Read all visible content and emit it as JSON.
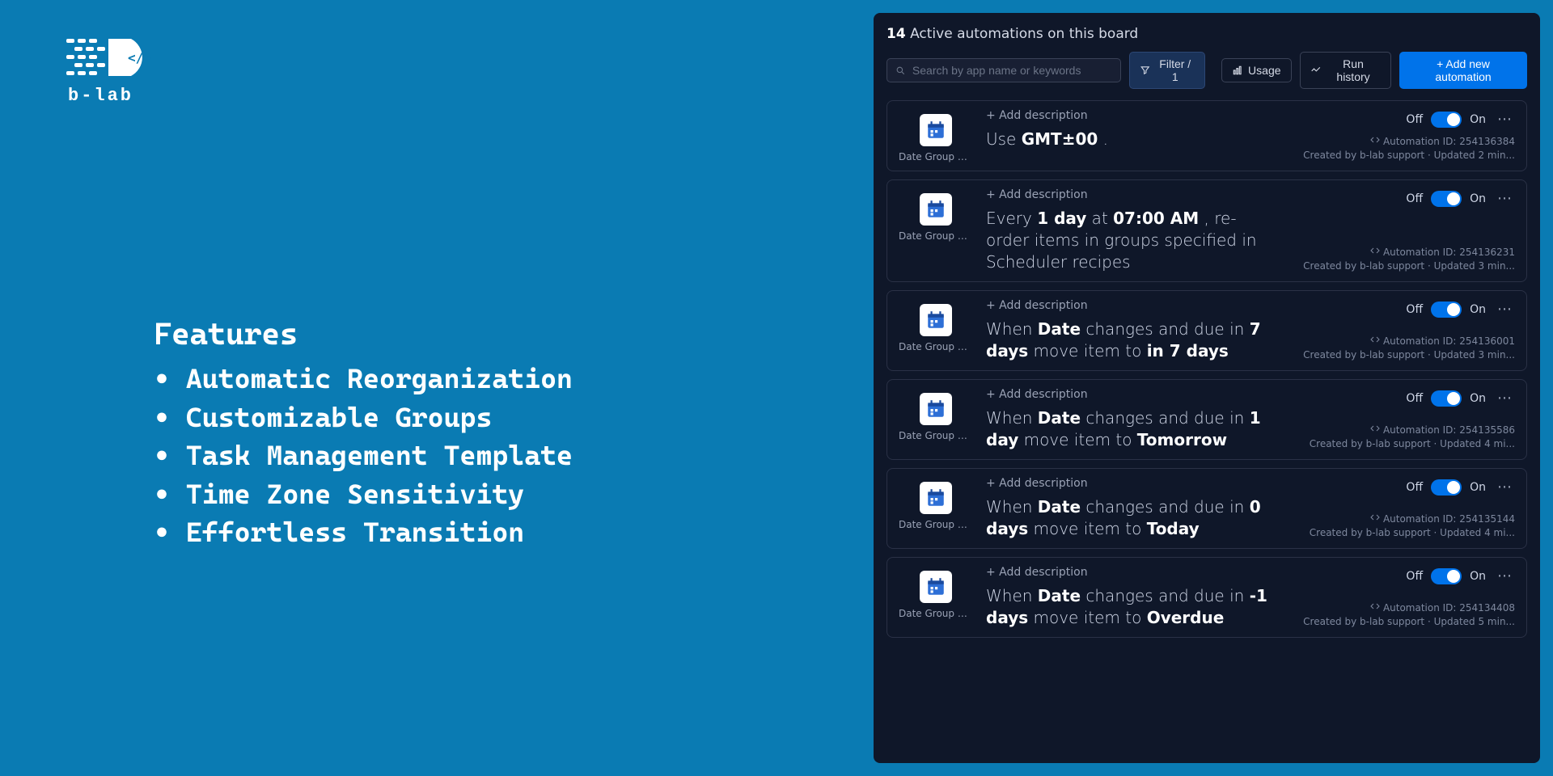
{
  "brand": "b-lab",
  "features": {
    "title": "Features",
    "items": [
      "Automatic Reorganization",
      "Customizable Groups",
      "Task Management Template",
      "Time Zone Sensitivity",
      "Effortless Transition"
    ]
  },
  "header": {
    "count": "14",
    "label": "Active automations on this board"
  },
  "toolbar": {
    "search_placeholder": "Search by app name or keywords",
    "filter_label": "Filter / 1",
    "usage_label": "Usage",
    "history_label": "Run history",
    "add_label": "+ Add new automation"
  },
  "common": {
    "add_description": "+ Add description",
    "off": "Off",
    "on": "On",
    "app_name": "Date Group Ma...",
    "automation_id_prefix": "Automation ID:",
    "created_by": "Created by b-lab support"
  },
  "automations": [
    {
      "sentence_html": "Use <b>GMT±00</b> .",
      "automation_id": "254136384",
      "updated": "Updated 2 min..."
    },
    {
      "sentence_html": "Every <b>1 day</b> at <b>07:00 AM</b> , re-order items in groups specified in Scheduler recipes",
      "automation_id": "254136231",
      "updated": "Updated 3 min..."
    },
    {
      "sentence_html": "When <b>Date</b> changes and due in <b>7 days</b> move item to <b>in 7 days</b>",
      "automation_id": "254136001",
      "updated": "Updated 3 min..."
    },
    {
      "sentence_html": "When <b>Date</b> changes and due in <b>1 day</b> move item to <b>Tomorrow</b>",
      "automation_id": "254135586",
      "updated": "Updated 4 mi..."
    },
    {
      "sentence_html": "When <b>Date</b> changes and due in <b>0 days</b> move item to <b>Today</b>",
      "automation_id": "254135144",
      "updated": "Updated 4 mi..."
    },
    {
      "sentence_html": "When <b>Date</b> changes and due in <b>-1 days</b> move item to <b>Overdue</b>",
      "automation_id": "254134408",
      "updated": "Updated 5 min..."
    }
  ]
}
